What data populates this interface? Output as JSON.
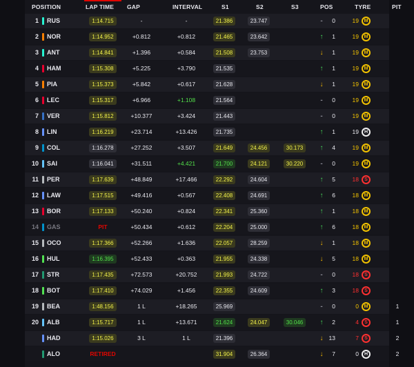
{
  "header": {
    "position": "POSITION",
    "lap_time": "LAP TIME",
    "gap": "GAP",
    "interval": "INTERVAL",
    "s1": "S1",
    "s2": "S2",
    "s3": "S3",
    "pos": "POS",
    "tyre": "TYRE",
    "pit": "PIT"
  },
  "colors": {
    "accent_red": "#e10600",
    "personal_best_green": "#53e04a",
    "sector_yellow": "#f2f24a",
    "position_up": "#47d45a",
    "position_down": "#f5b800",
    "medium": "#f2c200",
    "hard": "#f0f0f0",
    "soft": "#ff3030"
  },
  "rows": [
    {
      "num": "1",
      "dim": false,
      "code": "RUS",
      "team": "#27f4d2",
      "lap": "1:14.715",
      "lap_style": "y",
      "gap": "-",
      "interval": "-",
      "interval_style": "",
      "s1": "21.386",
      "s1_style": "y",
      "s2": "23.747",
      "s2_style": "w",
      "s3": "",
      "s3_style": "",
      "dir": "flat",
      "arrow": "-",
      "posval": "0",
      "tyre_laps": "19",
      "tyre": "medium",
      "tyre_letter": "M",
      "pit": ""
    },
    {
      "num": "2",
      "dim": false,
      "code": "NOR",
      "team": "#ff8000",
      "lap": "1:14.952",
      "lap_style": "y",
      "gap": "+0.812",
      "interval": "+0.812",
      "interval_style": "",
      "s1": "21.465",
      "s1_style": "y",
      "s2": "23.642",
      "s2_style": "w",
      "s3": "",
      "s3_style": "",
      "dir": "up",
      "arrow": "↑",
      "posval": "1",
      "tyre_laps": "19",
      "tyre": "medium",
      "tyre_letter": "M",
      "pit": ""
    },
    {
      "num": "3",
      "dim": false,
      "code": "ANT",
      "team": "#27f4d2",
      "lap": "1:14.841",
      "lap_style": "y",
      "gap": "+1.396",
      "interval": "+0.584",
      "interval_style": "",
      "s1": "21.508",
      "s1_style": "y",
      "s2": "23.753",
      "s2_style": "w",
      "s3": "",
      "s3_style": "",
      "dir": "down",
      "arrow": "↓",
      "posval": "1",
      "tyre_laps": "19",
      "tyre": "medium",
      "tyre_letter": "M",
      "pit": ""
    },
    {
      "num": "4",
      "dim": false,
      "code": "HAM",
      "team": "#e8002d",
      "lap": "1:15.308",
      "lap_style": "y",
      "gap": "+5.225",
      "interval": "+3.790",
      "interval_style": "",
      "s1": "21.535",
      "s1_style": "",
      "s2": "",
      "s2_style": "",
      "s3": "",
      "s3_style": "",
      "dir": "up",
      "arrow": "↑",
      "posval": "1",
      "tyre_laps": "19",
      "tyre": "medium",
      "tyre_letter": "M",
      "pit": ""
    },
    {
      "num": "5",
      "dim": false,
      "code": "PIA",
      "team": "#ff8000",
      "lap": "1:15.373",
      "lap_style": "y",
      "gap": "+5.842",
      "interval": "+0.617",
      "interval_style": "",
      "s1": "21.628",
      "s1_style": "",
      "s2": "",
      "s2_style": "",
      "s3": "",
      "s3_style": "",
      "dir": "down",
      "arrow": "↓",
      "posval": "1",
      "tyre_laps": "19",
      "tyre": "medium",
      "tyre_letter": "M",
      "pit": ""
    },
    {
      "num": "6",
      "dim": false,
      "code": "LEC",
      "team": "#e8002d",
      "lap": "1:15.317",
      "lap_style": "y",
      "gap": "+6.966",
      "interval": "+1.108",
      "interval_style": "green",
      "s1": "21.564",
      "s1_style": "",
      "s2": "",
      "s2_style": "",
      "s3": "",
      "s3_style": "",
      "dir": "flat",
      "arrow": "-",
      "posval": "0",
      "tyre_laps": "19",
      "tyre": "medium",
      "tyre_letter": "M",
      "pit": ""
    },
    {
      "num": "7",
      "dim": false,
      "code": "VER",
      "team": "#3671c6",
      "lap": "1:15.812",
      "lap_style": "y",
      "gap": "+10.377",
      "interval": "+3.424",
      "interval_style": "",
      "s1": "21.443",
      "s1_style": "",
      "s2": "",
      "s2_style": "",
      "s3": "",
      "s3_style": "",
      "dir": "flat",
      "arrow": "-",
      "posval": "0",
      "tyre_laps": "19",
      "tyre": "medium",
      "tyre_letter": "M",
      "pit": ""
    },
    {
      "num": "8",
      "dim": false,
      "code": "LIN",
      "team": "#6692ff",
      "lap": "1:16.219",
      "lap_style": "y",
      "gap": "+23.714",
      "interval": "+13.426",
      "interval_style": "",
      "s1": "21.735",
      "s1_style": "",
      "s2": "",
      "s2_style": "",
      "s3": "",
      "s3_style": "",
      "dir": "up",
      "arrow": "↑",
      "posval": "1",
      "tyre_laps": "19",
      "tyre": "hard",
      "tyre_letter": "H",
      "pit": ""
    },
    {
      "num": "9",
      "dim": false,
      "code": "COL",
      "team": "#0093cc",
      "lap": "1:16.278",
      "lap_style": "w",
      "gap": "+27.252",
      "interval": "+3.507",
      "interval_style": "",
      "s1": "21.649",
      "s1_style": "y",
      "s2": "24.456",
      "s2_style": "y",
      "s3": "30.173",
      "s3_style": "y",
      "dir": "up",
      "arrow": "↑",
      "posval": "4",
      "tyre_laps": "19",
      "tyre": "medium",
      "tyre_letter": "M",
      "pit": ""
    },
    {
      "num": "10",
      "dim": false,
      "code": "SAI",
      "team": "#64c4ff",
      "lap": "1:16.041",
      "lap_style": "w",
      "gap": "+31.511",
      "interval": "+4.421",
      "interval_style": "green",
      "s1": "21.700",
      "s1_style": "g",
      "s2": "24.121",
      "s2_style": "y",
      "s3": "30.220",
      "s3_style": "y",
      "dir": "flat",
      "arrow": "-",
      "posval": "0",
      "tyre_laps": "19",
      "tyre": "medium",
      "tyre_letter": "M",
      "pit": ""
    },
    {
      "num": "11",
      "dim": false,
      "code": "PER",
      "team": "#b6babd",
      "lap": "1:17.639",
      "lap_style": "y",
      "gap": "+48.849",
      "interval": "+17.466",
      "interval_style": "",
      "s1": "22.292",
      "s1_style": "y",
      "s2": "24.604",
      "s2_style": "w",
      "s3": "",
      "s3_style": "",
      "dir": "up",
      "arrow": "↑",
      "posval": "5",
      "tyre_laps": "18",
      "tyre": "soft",
      "tyre_letter": "S",
      "pit": ""
    },
    {
      "num": "12",
      "dim": false,
      "code": "LAW",
      "team": "#6692ff",
      "lap": "1:17.515",
      "lap_style": "y",
      "gap": "+49.416",
      "interval": "+0.567",
      "interval_style": "",
      "s1": "22.408",
      "s1_style": "y",
      "s2": "24.691",
      "s2_style": "w",
      "s3": "",
      "s3_style": "",
      "dir": "up",
      "arrow": "↑",
      "posval": "6",
      "tyre_laps": "18",
      "tyre": "medium",
      "tyre_letter": "M",
      "pit": ""
    },
    {
      "num": "13",
      "dim": false,
      "code": "BOR",
      "team": "#e8002d",
      "lap": "1:17.133",
      "lap_style": "y",
      "gap": "+50.240",
      "interval": "+0.824",
      "interval_style": "",
      "s1": "22.341",
      "s1_style": "y",
      "s2": "25.360",
      "s2_style": "w",
      "s3": "",
      "s3_style": "",
      "dir": "up",
      "arrow": "↑",
      "posval": "1",
      "tyre_laps": "18",
      "tyre": "medium",
      "tyre_letter": "M",
      "pit": ""
    },
    {
      "num": "14",
      "dim": true,
      "code": "GAS",
      "team": "#0093cc",
      "lap": "PIT",
      "lap_style": "status",
      "gap": "+50.434",
      "interval": "+0.612",
      "interval_style": "",
      "s1": "22.204",
      "s1_style": "y",
      "s2": "25.000",
      "s2_style": "w",
      "s3": "",
      "s3_style": "",
      "dir": "up",
      "arrow": "↑",
      "posval": "6",
      "tyre_laps": "18",
      "tyre": "medium",
      "tyre_letter": "M",
      "pit": ""
    },
    {
      "num": "15",
      "dim": false,
      "code": "OCO",
      "team": "#b6babd",
      "lap": "1:17.366",
      "lap_style": "y",
      "gap": "+52.266",
      "interval": "+1.636",
      "interval_style": "",
      "s1": "22.057",
      "s1_style": "y",
      "s2": "28.259",
      "s2_style": "w",
      "s3": "",
      "s3_style": "",
      "dir": "down",
      "arrow": "↓",
      "posval": "1",
      "tyre_laps": "18",
      "tyre": "medium",
      "tyre_letter": "M",
      "pit": ""
    },
    {
      "num": "16",
      "dim": false,
      "code": "HUL",
      "team": "#52e252",
      "lap": "1:16.395",
      "lap_style": "g",
      "gap": "+52.433",
      "interval": "+0.363",
      "interval_style": "",
      "s1": "21.955",
      "s1_style": "y",
      "s2": "24.338",
      "s2_style": "w",
      "s3": "",
      "s3_style": "",
      "dir": "down",
      "arrow": "↓",
      "posval": "5",
      "tyre_laps": "18",
      "tyre": "medium",
      "tyre_letter": "M",
      "pit": ""
    },
    {
      "num": "17",
      "dim": false,
      "code": "STR",
      "team": "#229971",
      "lap": "1:17.435",
      "lap_style": "y",
      "gap": "+72.573",
      "interval": "+20.752",
      "interval_style": "",
      "s1": "21.993",
      "s1_style": "y",
      "s2": "24.722",
      "s2_style": "w",
      "s3": "",
      "s3_style": "",
      "dir": "flat",
      "arrow": "-",
      "posval": "0",
      "tyre_laps": "18",
      "tyre": "soft",
      "tyre_letter": "S",
      "pit": ""
    },
    {
      "num": "18",
      "dim": false,
      "code": "BOT",
      "team": "#52e252",
      "lap": "1:17.410",
      "lap_style": "y",
      "gap": "+74.029",
      "interval": "+1.456",
      "interval_style": "",
      "s1": "22.355",
      "s1_style": "y",
      "s2": "24.609",
      "s2_style": "w",
      "s3": "",
      "s3_style": "",
      "dir": "up",
      "arrow": "↑",
      "posval": "3",
      "tyre_laps": "18",
      "tyre": "soft",
      "tyre_letter": "S",
      "pit": ""
    },
    {
      "num": "19",
      "dim": false,
      "code": "BEA",
      "team": "#b6babd",
      "lap": "1:48.156",
      "lap_style": "y",
      "gap": "1 L",
      "interval": "+18.265",
      "interval_style": "",
      "s1": "25.969",
      "s1_style": "w",
      "s2": "",
      "s2_style": "",
      "s3": "",
      "s3_style": "",
      "dir": "flat",
      "arrow": "-",
      "posval": "0",
      "tyre_laps": "0",
      "tyre": "medium",
      "tyre_letter": "M",
      "pit": "1"
    },
    {
      "num": "20",
      "dim": false,
      "code": "ALB",
      "team": "#64c4ff",
      "lap": "1:15.717",
      "lap_style": "y",
      "gap": "1 L",
      "interval": "+13.671",
      "interval_style": "",
      "s1": "21.624",
      "s1_style": "g",
      "s2": "24.047",
      "s2_style": "y",
      "s3": "30.046",
      "s3_style": "g",
      "dir": "up",
      "arrow": "↑",
      "posval": "2",
      "tyre_laps": "4",
      "tyre": "soft",
      "tyre_letter": "S",
      "pit": "1"
    },
    {
      "num": "",
      "dim": false,
      "code": "HAD",
      "team": "#6692ff",
      "lap": "1:15.026",
      "lap_style": "y",
      "gap": "3 L",
      "interval": "1 L",
      "interval_style": "",
      "s1": "21.396",
      "s1_style": "w",
      "s2": "",
      "s2_style": "",
      "s3": "",
      "s3_style": "",
      "dir": "down",
      "arrow": "↓",
      "posval": "13",
      "tyre_laps": "7",
      "tyre": "soft",
      "tyre_letter": "S",
      "pit": "2"
    },
    {
      "num": "",
      "dim": false,
      "code": "ALO",
      "team": "#229971",
      "lap": "RETIRED",
      "lap_style": "status",
      "gap": "",
      "interval": "",
      "interval_style": "",
      "s1": "31.904",
      "s1_style": "y",
      "s2": "26.364",
      "s2_style": "w",
      "s3": "",
      "s3_style": "",
      "dir": "down",
      "arrow": "↓",
      "posval": "7",
      "tyre_laps": "0",
      "tyre": "hard",
      "tyre_letter": "H",
      "pit": "2"
    }
  ]
}
